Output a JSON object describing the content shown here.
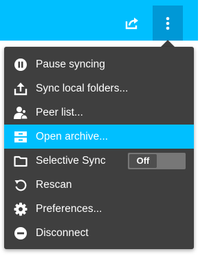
{
  "toolbar": {
    "share_icon": "share-arrow-icon",
    "more_icon": "vertical-dots-icon",
    "bar_color": "#00bfff",
    "active_button_color": "#0098d6"
  },
  "menu": {
    "background": "#3f3f3f",
    "highlight_color": "#00bfff",
    "items": [
      {
        "label": "Pause syncing",
        "icon": "pause-icon"
      },
      {
        "label": "Sync local folders...",
        "icon": "upload-icon"
      },
      {
        "label": "Peer list...",
        "icon": "people-icon"
      },
      {
        "label": "Open archive...",
        "icon": "archive-icon",
        "highlighted": true
      },
      {
        "label": "Selective Sync",
        "icon": "folder-icon",
        "toggle": "Off"
      },
      {
        "label": "Rescan",
        "icon": "refresh-icon"
      },
      {
        "label": "Preferences...",
        "icon": "gear-icon"
      },
      {
        "label": "Disconnect",
        "icon": "disconnect-icon"
      }
    ]
  }
}
